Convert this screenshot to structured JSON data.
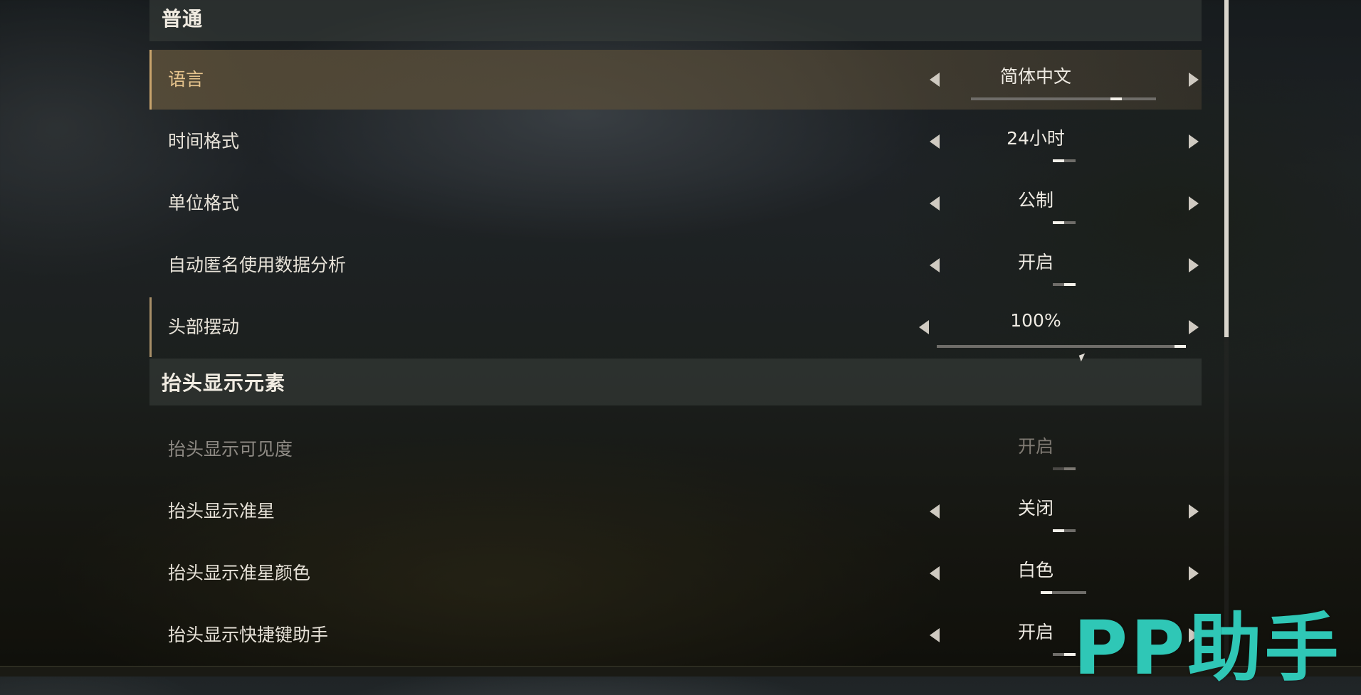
{
  "sections": [
    {
      "title": "普通",
      "rows": [
        {
          "label": "语言",
          "value": "简体中文",
          "selected": true,
          "disabled": false,
          "progress": 0.8
        },
        {
          "label": "时间格式",
          "value": "24小时",
          "selected": false,
          "disabled": false,
          "progress": 0.5
        },
        {
          "label": "单位格式",
          "value": "公制",
          "selected": false,
          "disabled": false,
          "progress": 0.5
        },
        {
          "label": "自动匿名使用数据分析",
          "value": "开启",
          "selected": false,
          "disabled": false,
          "progress": 1.0
        },
        {
          "label": "头部摆动",
          "value": "100%",
          "selected": false,
          "disabled": false,
          "progress": 1.0
        }
      ]
    },
    {
      "title": "抬头显示元素",
      "rows": [
        {
          "label": "抬头显示可见度",
          "value": "开启",
          "selected": false,
          "disabled": true,
          "progress": 1.0
        },
        {
          "label": "抬头显示准星",
          "value": "关闭",
          "selected": false,
          "disabled": false,
          "progress": 0.5
        },
        {
          "label": "抬头显示准星颜色",
          "value": "白色",
          "selected": false,
          "disabled": false,
          "progress": 0.25
        },
        {
          "label": "抬头显示快捷键助手",
          "value": "开启",
          "selected": false,
          "disabled": false,
          "progress": 1.0
        }
      ]
    }
  ],
  "scrollbar": {
    "position": 0.0,
    "visible_fraction": 0.5
  },
  "watermark": "PP助手",
  "colors": {
    "accent": "#c9a46c",
    "selected_label": "#e6c48d",
    "watermark": "#2fc7b6"
  }
}
